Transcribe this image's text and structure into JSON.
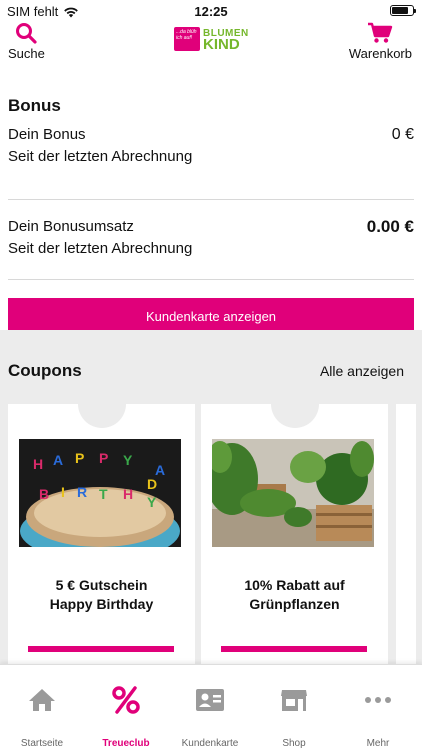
{
  "status_bar": {
    "carrier": "SIM fehlt",
    "time": "12:25"
  },
  "header": {
    "search_label": "Suche",
    "cart_label": "Warenkorb",
    "logo_tagline": "...da blüh ich auf!",
    "logo_line1": "BLUMEN",
    "logo_line2": "KIND"
  },
  "bonus": {
    "title": "Bonus",
    "rows": [
      {
        "label": "Dein Bonus",
        "sub": "Seit der letzten Abrechnung",
        "value": "0 €"
      },
      {
        "label": "Dein Bonusumsatz",
        "sub": "Seit der letzten Abrechnung",
        "value": "0.00 €"
      }
    ],
    "button_label": "Kundenkarte anzeigen"
  },
  "coupons": {
    "title": "Coupons",
    "show_all_label": "Alle anzeigen",
    "items": [
      {
        "title_line1": "5 € Gutschein",
        "title_line2": "Happy Birthday",
        "image": "birthday-cake-candles"
      },
      {
        "title_line1": "10% Rabatt auf",
        "title_line2": "Grünpflanzen",
        "image": "green-plants"
      }
    ]
  },
  "tabs": [
    {
      "label": "Startseite",
      "icon": "home-icon",
      "active": false
    },
    {
      "label": "Treueclub",
      "icon": "percent-icon",
      "active": true
    },
    {
      "label": "Kundenkarte",
      "icon": "id-card-icon",
      "active": false
    },
    {
      "label": "Shop",
      "icon": "store-icon",
      "active": false
    },
    {
      "label": "Mehr",
      "icon": "more-icon",
      "active": false
    }
  ],
  "colors": {
    "accent": "#e0007a",
    "logo_green": "#75b72c",
    "tab_inactive": "#9a9a9a",
    "section_bg": "#ececec"
  }
}
